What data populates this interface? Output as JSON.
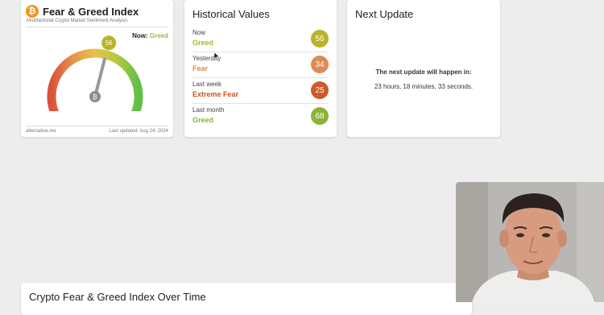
{
  "fear_greed": {
    "title": "Fear & Greed Index",
    "subtitle": "Multifactorial Crypto Market Sentiment Analysis",
    "now_label": "Now:",
    "now_value": "Greed",
    "value": 56,
    "footer_source": "alternative.me",
    "footer_updated": "Last updated: Aug 24, 2024",
    "logo_glyph": "₿"
  },
  "historical": {
    "title": "Historical Values",
    "rows": [
      {
        "period": "Now",
        "classification": "Greed",
        "value": "56",
        "color": "#b9b327",
        "text_color": "#a9b628"
      },
      {
        "period": "Yesterday",
        "classification": "Fear",
        "value": "34",
        "color": "#e08a55",
        "text_color": "#e08a44"
      },
      {
        "period": "Last week",
        "classification": "Extreme Fear",
        "value": "25",
        "color": "#cf5a2a",
        "text_color": "#c9551e"
      },
      {
        "period": "Last month",
        "classification": "Greed",
        "value": "68",
        "color": "#8db23a",
        "text_color": "#8bb43a"
      }
    ]
  },
  "next_update": {
    "title": "Next Update",
    "line1": "The next update will happen in:",
    "line2": "23 hours, 18 minutes, 33 seconds."
  },
  "over_time": {
    "title": "Crypto Fear & Greed Index Over Time"
  },
  "colors": {
    "greed": "#a9b628",
    "fear": "#e08a44",
    "extreme_fear": "#c9551e",
    "gauge_red": "#d9533b",
    "gauge_green": "#6cc04a",
    "background": "#ededed"
  }
}
